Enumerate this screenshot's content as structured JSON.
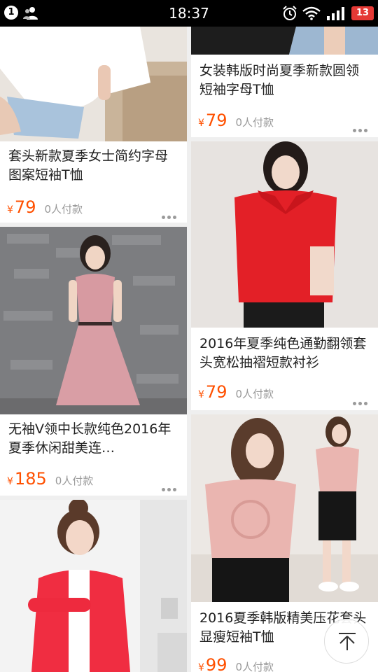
{
  "status_bar": {
    "notification_count": "1",
    "time": "18:37",
    "battery": "13"
  },
  "icons": {
    "people": "people-icon",
    "alarm": "alarm-icon",
    "wifi": "wifi-icon",
    "signal": "signal-icon",
    "more": "more-dots-icon",
    "back_to_top": "back-to-top-icon"
  },
  "colors": {
    "price": "#ff5000",
    "sold_text": "#999999",
    "background": "#efefef",
    "battery": "#e53935"
  },
  "currency_symbol": "¥",
  "products": [
    {
      "title": "套头新款夏季女士简约字母图案短袖T恤",
      "price": "79",
      "sold": "0人付款"
    },
    {
      "title": "女装韩版时尚夏季新款圆领短袖字母T恤",
      "price": "79",
      "sold": "0人付款"
    },
    {
      "title": "无袖V领中长款纯色2016年夏季休闲甜美连…",
      "price": "185",
      "sold": "0人付款"
    },
    {
      "title": "2016年夏季纯色通勤翻领套头宽松抽褶短款衬衫",
      "price": "79",
      "sold": "0人付款"
    },
    {
      "title": "",
      "price": "",
      "sold": ""
    },
    {
      "title": "2016夏季韩版精美压花套头显瘦短袖T恤",
      "price": "99",
      "sold": "0人付款"
    }
  ]
}
